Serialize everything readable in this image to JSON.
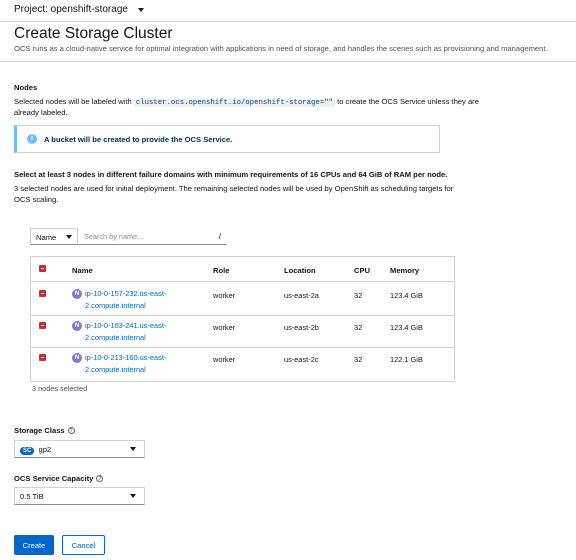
{
  "project": {
    "label": "Project: openshift-storage"
  },
  "page": {
    "title": "Create Storage Cluster",
    "description": "OCS runs as a cloud-native service for optimal integration with applications in need of storage, and handles the scenes such as provisioning and management."
  },
  "nodes_section": {
    "heading": "Nodes",
    "intro_before": "Selected nodes will be labeled with",
    "intro_code": "cluster.ocs.openshift.io/openshift-storage=\"\"",
    "intro_after": "to create the OCS Service unless they are",
    "intro_line2": "already labeled.",
    "alert": "A bucket will be created to provide the OCS Service.",
    "requirements": "Select at least 3 nodes in different failure domains with minimum requirements of 16 CPUs and 64 GiB of RAM per node.",
    "note_line1": "3 selected nodes are used for initial deployment. The remaining selected nodes will be used by OpenShift as scheduling targets for",
    "note_line2": "OCS scaling."
  },
  "filter": {
    "field": "Name",
    "placeholder": "Search by name...",
    "shortcut": "/"
  },
  "table": {
    "columns": {
      "name": "Name",
      "role": "Role",
      "location": "Location",
      "cpu": "CPU",
      "memory": "Memory"
    },
    "rows": [
      {
        "badge": "N",
        "name": "ip-10-0-157-232.us-east-2.compute.internal",
        "role": "worker",
        "location": "us-east-2a",
        "cpu": "32",
        "memory": "123.4 GiB"
      },
      {
        "badge": "N",
        "name": "ip-10-0-163-241.us-east-2.compute.internal",
        "role": "worker",
        "location": "us-east-2b",
        "cpu": "32",
        "memory": "123.4 GiB"
      },
      {
        "badge": "N",
        "name": "ip-10-0-213-160.us-east-2.compute.internal",
        "role": "worker",
        "location": "us-east-2c",
        "cpu": "32",
        "memory": "122.1 GiB"
      }
    ],
    "selected_count": "3 nodes selected"
  },
  "storage_class": {
    "label": "Storage Class",
    "badge": "SC",
    "value": "gp2"
  },
  "capacity": {
    "label": "OCS Service Capacity",
    "value": "0.5 TiB"
  },
  "actions": {
    "create": "Create",
    "cancel": "Cancel"
  },
  "colors": {
    "primary": "#0066cc",
    "checkbox": "#d8232a",
    "node_badge": "#8476d1",
    "alert_border": "#73bcf7"
  }
}
